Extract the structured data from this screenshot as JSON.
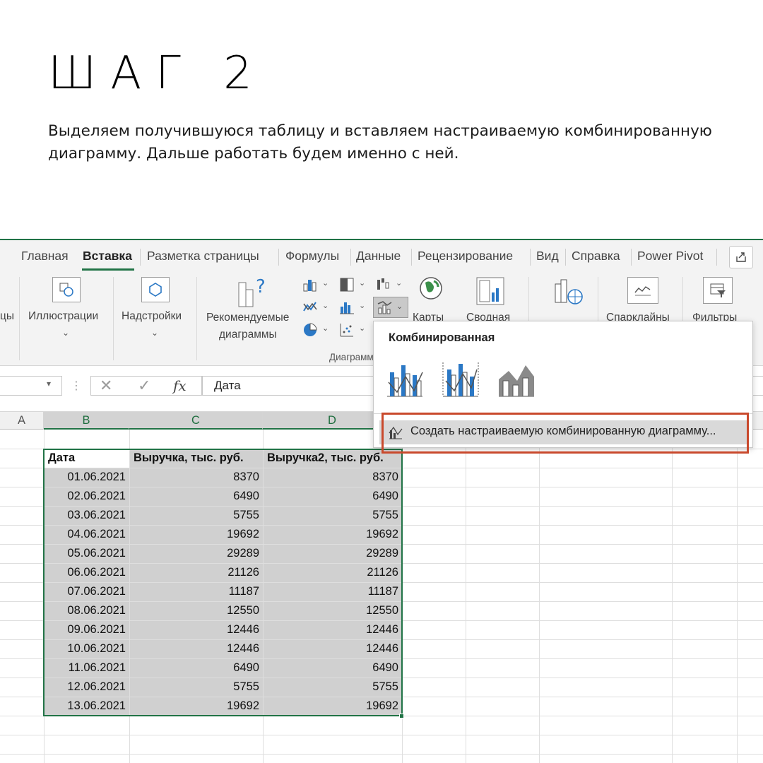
{
  "header": {
    "title": "ШАГ 2",
    "description": "Выделяем получившуюся таблицу и вставляем настраиваемую комбинированную диаграмму. Дальше работать будем именно с ней."
  },
  "ribbon_tabs": [
    "Главная",
    "Вставка",
    "Разметка страницы",
    "Формулы",
    "Данные",
    "Рецензирование",
    "Вид",
    "Справка",
    "Power Pivot"
  ],
  "ribbon": {
    "cut_left_label": "цы",
    "illustrations": "Иллюстрации",
    "addins": "Надстройки",
    "recommended_charts_line1": "Рекомендуемые",
    "recommended_charts_line2": "диаграммы",
    "maps": "Карты",
    "pivot_chart": "Сводная",
    "sparklines": "Спарклайны",
    "filters": "Фильтры",
    "charts_group": "Диаграмм"
  },
  "formula_bar": {
    "fx": "fx",
    "value": "Дата"
  },
  "columns": [
    "A",
    "B",
    "C",
    "D"
  ],
  "table": {
    "headers": [
      "Дата",
      "Выручка, тыс. руб.",
      "Выручка2, тыс. руб."
    ],
    "rows": [
      [
        "01.06.2021",
        "8370",
        "8370"
      ],
      [
        "02.06.2021",
        "6490",
        "6490"
      ],
      [
        "03.06.2021",
        "5755",
        "5755"
      ],
      [
        "04.06.2021",
        "19692",
        "19692"
      ],
      [
        "05.06.2021",
        "29289",
        "29289"
      ],
      [
        "06.06.2021",
        "21126",
        "21126"
      ],
      [
        "07.06.2021",
        "11187",
        "11187"
      ],
      [
        "08.06.2021",
        "12550",
        "12550"
      ],
      [
        "09.06.2021",
        "12446",
        "12446"
      ],
      [
        "10.06.2021",
        "12446",
        "12446"
      ],
      [
        "11.06.2021",
        "6490",
        "6490"
      ],
      [
        "12.06.2021",
        "5755",
        "5755"
      ],
      [
        "13.06.2021",
        "19692",
        "19692"
      ]
    ]
  },
  "combo_popup": {
    "title": "Комбинированная",
    "create_custom": "Создать настраиваемую комбинированную диаграмму..."
  },
  "colors": {
    "excel_green": "#217346",
    "highlight_red": "#c9492c",
    "selection_gray": "#d0d0d0"
  }
}
